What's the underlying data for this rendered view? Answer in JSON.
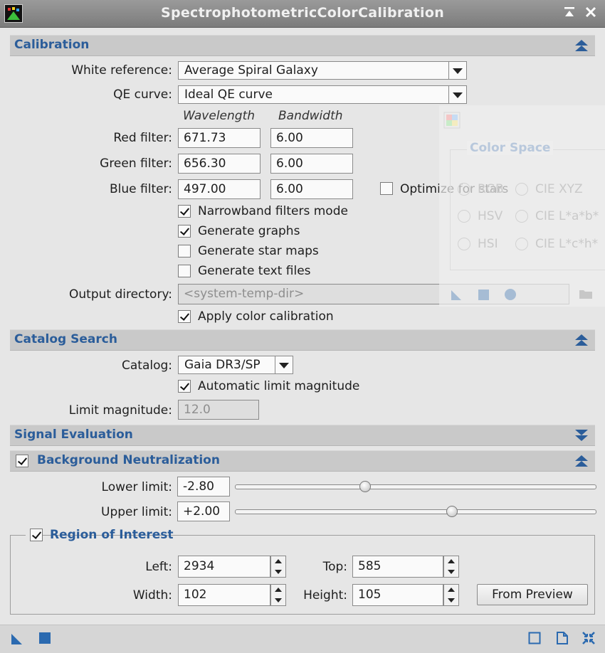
{
  "window": {
    "title": "SpectrophotometricColorCalibration"
  },
  "calibration": {
    "header": "Calibration",
    "white_reference_label": "White reference:",
    "white_reference_value": "Average Spiral Galaxy",
    "qe_curve_label": "QE curve:",
    "qe_curve_value": "Ideal QE curve",
    "col_wavelength": "Wavelength",
    "col_bandwidth": "Bandwidth",
    "red_label": "Red filter:",
    "red_wavelength": "671.73",
    "red_bandwidth": "6.00",
    "green_label": "Green filter:",
    "green_wavelength": "656.30",
    "green_bandwidth": "6.00",
    "blue_label": "Blue filter:",
    "blue_wavelength": "497.00",
    "blue_bandwidth": "6.00",
    "optimize_stars_label": "Optimize for stars",
    "optimize_stars_checked": false,
    "narrowband_label": "Narrowband filters mode",
    "narrowband_checked": true,
    "graphs_label": "Generate graphs",
    "graphs_checked": true,
    "starmaps_label": "Generate star maps",
    "starmaps_checked": false,
    "textfiles_label": "Generate text files",
    "textfiles_checked": false,
    "output_dir_label": "Output directory:",
    "output_dir_placeholder": "<system-temp-dir>",
    "apply_label": "Apply color calibration",
    "apply_checked": true
  },
  "catalog_search": {
    "header": "Catalog Search",
    "catalog_label": "Catalog:",
    "catalog_value": "Gaia DR3/SP",
    "auto_limit_label": "Automatic limit magnitude",
    "auto_limit_checked": true,
    "limit_mag_label": "Limit magnitude:",
    "limit_mag_value": "12.0"
  },
  "signal_evaluation": {
    "header": "Signal Evaluation"
  },
  "background_neutralization": {
    "header": "Background Neutralization",
    "enabled": true,
    "lower_label": "Lower limit:",
    "lower_value": "-2.80",
    "lower_fraction": 0.36,
    "upper_label": "Upper limit:",
    "upper_value": "+2.00",
    "upper_fraction": 0.6,
    "roi": {
      "title": "Region of Interest",
      "enabled": true,
      "left_label": "Left:",
      "left_value": "2934",
      "top_label": "Top:",
      "top_value": "585",
      "width_label": "Width:",
      "width_value": "102",
      "height_label": "Height:",
      "height_value": "105",
      "from_preview_label": "From Preview"
    }
  },
  "ghost_panel": {
    "title": "Color Space",
    "options": [
      "RGB",
      "CIE XYZ",
      "HSV",
      "CIE L*a*b*",
      "HSI",
      "CIE L*c*h*"
    ]
  },
  "colors": {
    "accent": "#2b5d9a",
    "section_bg": "#c9c9c9",
    "panel_bg": "#e6e6e6",
    "titlebar": "#8a8a8a"
  }
}
